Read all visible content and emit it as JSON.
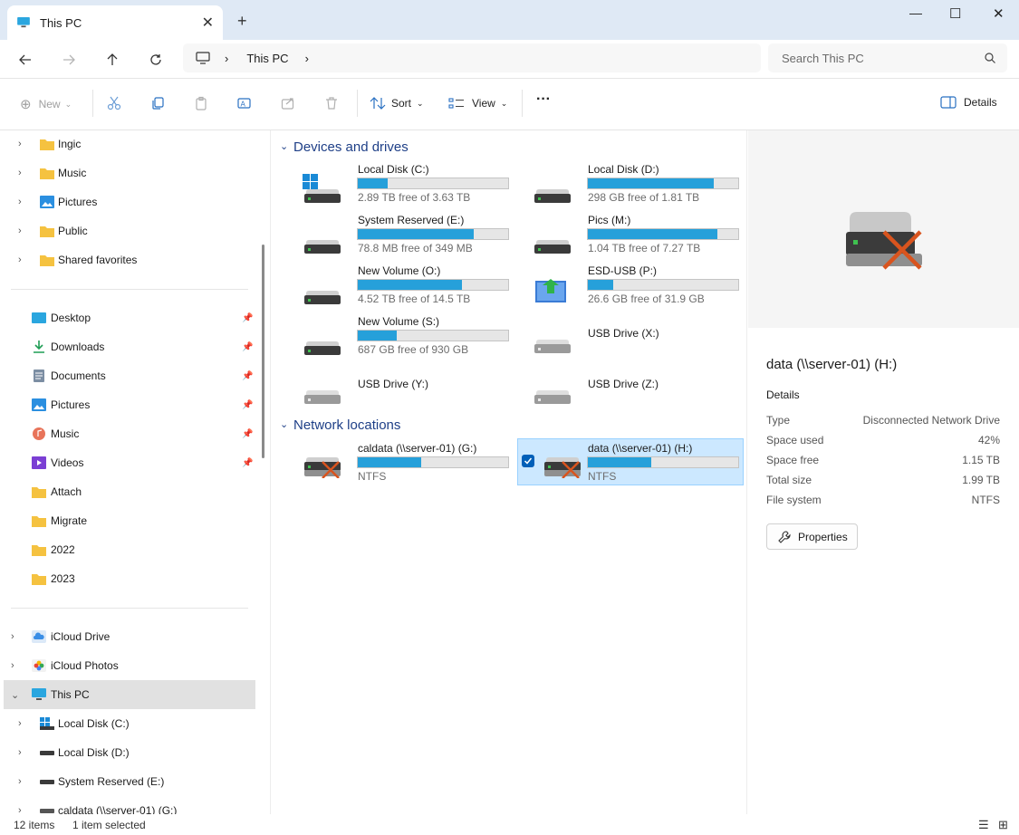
{
  "window": {
    "tab_title": "This PC",
    "new_tab": "+",
    "minimize": "—",
    "maximize": "☐",
    "close": "✕"
  },
  "nav": {
    "address_crumb": "This PC",
    "search_placeholder": "Search This PC"
  },
  "toolbar": {
    "new_label": "New",
    "sort_label": "Sort",
    "view_label": "View",
    "more_label": "···",
    "details_label": "Details"
  },
  "sidebar": {
    "top_items": [
      {
        "label": "Ingic"
      },
      {
        "label": "Music"
      },
      {
        "label": "Pictures"
      },
      {
        "label": "Public"
      },
      {
        "label": "Shared favorites"
      }
    ],
    "quick_items": [
      {
        "label": "Desktop",
        "pinned": true
      },
      {
        "label": "Downloads",
        "pinned": true
      },
      {
        "label": "Documents",
        "pinned": true
      },
      {
        "label": "Pictures",
        "pinned": true
      },
      {
        "label": "Music",
        "pinned": true
      },
      {
        "label": "Videos",
        "pinned": true
      },
      {
        "label": "Attach",
        "pinned": false
      },
      {
        "label": "Migrate",
        "pinned": false
      },
      {
        "label": "2022",
        "pinned": false
      },
      {
        "label": "2023",
        "pinned": false
      }
    ],
    "bottom_items": [
      {
        "label": "iCloud Drive"
      },
      {
        "label": "iCloud Photos"
      },
      {
        "label": "This PC"
      },
      {
        "label": "Local Disk (C:)"
      },
      {
        "label": "Local Disk (D:)"
      },
      {
        "label": "System Reserved (E:)"
      },
      {
        "label": "caldata (\\\\server-01) (G:)"
      }
    ]
  },
  "main": {
    "devices_header": "Devices and drives",
    "network_header": "Network locations",
    "drives": [
      {
        "name": "Local Disk (C:)",
        "free": "2.89 TB free of 3.63 TB",
        "used_fraction": 0.2
      },
      {
        "name": "Local Disk (D:)",
        "free": "298 GB free of 1.81 TB",
        "used_fraction": 0.84
      },
      {
        "name": "System Reserved (E:)",
        "free": "78.8 MB free of 349 MB",
        "used_fraction": 0.77
      },
      {
        "name": "Pics (M:)",
        "free": "1.04 TB free of 7.27 TB",
        "used_fraction": 0.86
      },
      {
        "name": "New Volume (O:)",
        "free": "4.52 TB free of 14.5 TB",
        "used_fraction": 0.69
      },
      {
        "name": "ESD-USB (P:)",
        "free": "26.6 GB free of 31.9 GB",
        "used_fraction": 0.17
      },
      {
        "name": "New Volume (S:)",
        "free": "687 GB free of 930 GB",
        "used_fraction": 0.26
      },
      {
        "name": "USB Drive (X:)"
      },
      {
        "name": "USB Drive (Y:)"
      },
      {
        "name": "USB Drive (Z:)"
      }
    ],
    "network": [
      {
        "name": "caldata (\\\\server-01) (G:)",
        "fs": "NTFS",
        "used_fraction": 0.42
      },
      {
        "name": "data (\\\\server-01) (H:)",
        "fs": "NTFS",
        "used_fraction": 0.42
      }
    ]
  },
  "details": {
    "title": "data (\\\\server-01) (H:)",
    "heading": "Details",
    "rows": [
      {
        "k": "Type",
        "v": "Disconnected Network Drive"
      },
      {
        "k": "Space used",
        "v": "42%"
      },
      {
        "k": "Space free",
        "v": "1.15 TB"
      },
      {
        "k": "Total size",
        "v": "1.99 TB"
      },
      {
        "k": "File system",
        "v": "NTFS"
      }
    ],
    "properties_label": "Properties"
  },
  "status": {
    "count": "12 items",
    "selected": "1 item selected"
  },
  "colors": {
    "accent": "#005fb8",
    "bar": "#26a0da",
    "select_bg": "#cce8ff",
    "folder": "#f5c240"
  }
}
